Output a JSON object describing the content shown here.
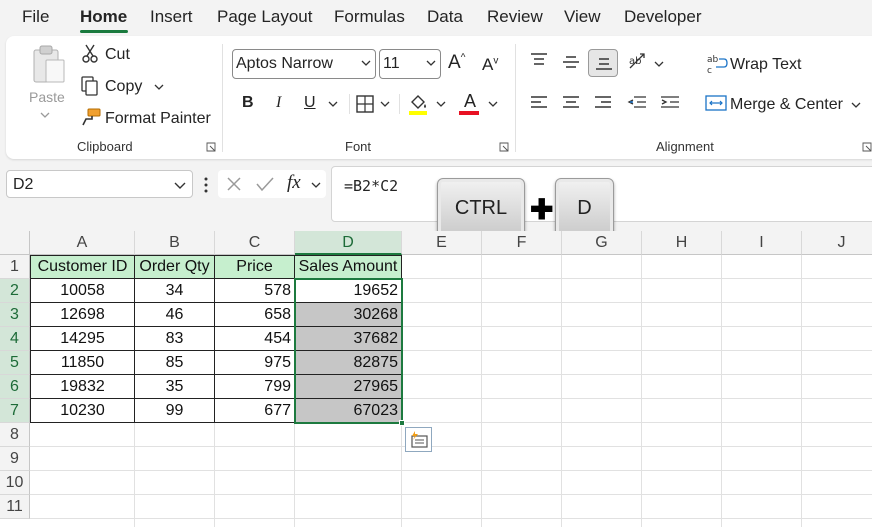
{
  "menu": {
    "items": [
      "File",
      "Home",
      "Insert",
      "Page Layout",
      "Formulas",
      "Data",
      "Review",
      "View",
      "Developer"
    ],
    "active": "Home"
  },
  "ribbon": {
    "clipboard": {
      "paste_label": "Paste",
      "cut_label": "Cut",
      "copy_label": "Copy",
      "format_painter_label": "Format Painter",
      "group_label": "Clipboard"
    },
    "font": {
      "font_name": "Aptos Narrow",
      "font_size": "11",
      "bold_label": "B",
      "italic_label": "I",
      "underline_label": "U",
      "group_label": "Font",
      "font_color": "#e81123",
      "highlight_color": "#ffff00"
    },
    "alignment": {
      "wrap_text_label": "Wrap Text",
      "merge_center_label": "Merge & Center",
      "group_label": "Alignment"
    }
  },
  "formula_bar": {
    "name_box": "D2",
    "formula": "=B2*C2"
  },
  "shortcut": {
    "key1": "CTRL",
    "plus": "✚",
    "key2": "D"
  },
  "sheet": {
    "columns": [
      "A",
      "B",
      "C",
      "D",
      "E",
      "F",
      "G",
      "H",
      "I",
      "J"
    ],
    "rows": [
      "1",
      "2",
      "3",
      "4",
      "5",
      "6",
      "7",
      "8",
      "9",
      "10",
      "11"
    ],
    "headers": [
      "Customer ID",
      "Order Qty",
      "Price",
      "Sales Amount"
    ],
    "data": [
      [
        "10058",
        "34",
        "578",
        "19652"
      ],
      [
        "12698",
        "46",
        "658",
        "30268"
      ],
      [
        "14295",
        "83",
        "454",
        "37682"
      ],
      [
        "11850",
        "85",
        "975",
        "82875"
      ],
      [
        "19832",
        "35",
        "799",
        "27965"
      ],
      [
        "10230",
        "99",
        "677",
        "67023"
      ]
    ],
    "selected_column": "D",
    "selected_range": "D2:D7",
    "header_fill": "#c6efce",
    "selection_fill": "#c6c6c6",
    "accent": "#1d7a3f"
  }
}
